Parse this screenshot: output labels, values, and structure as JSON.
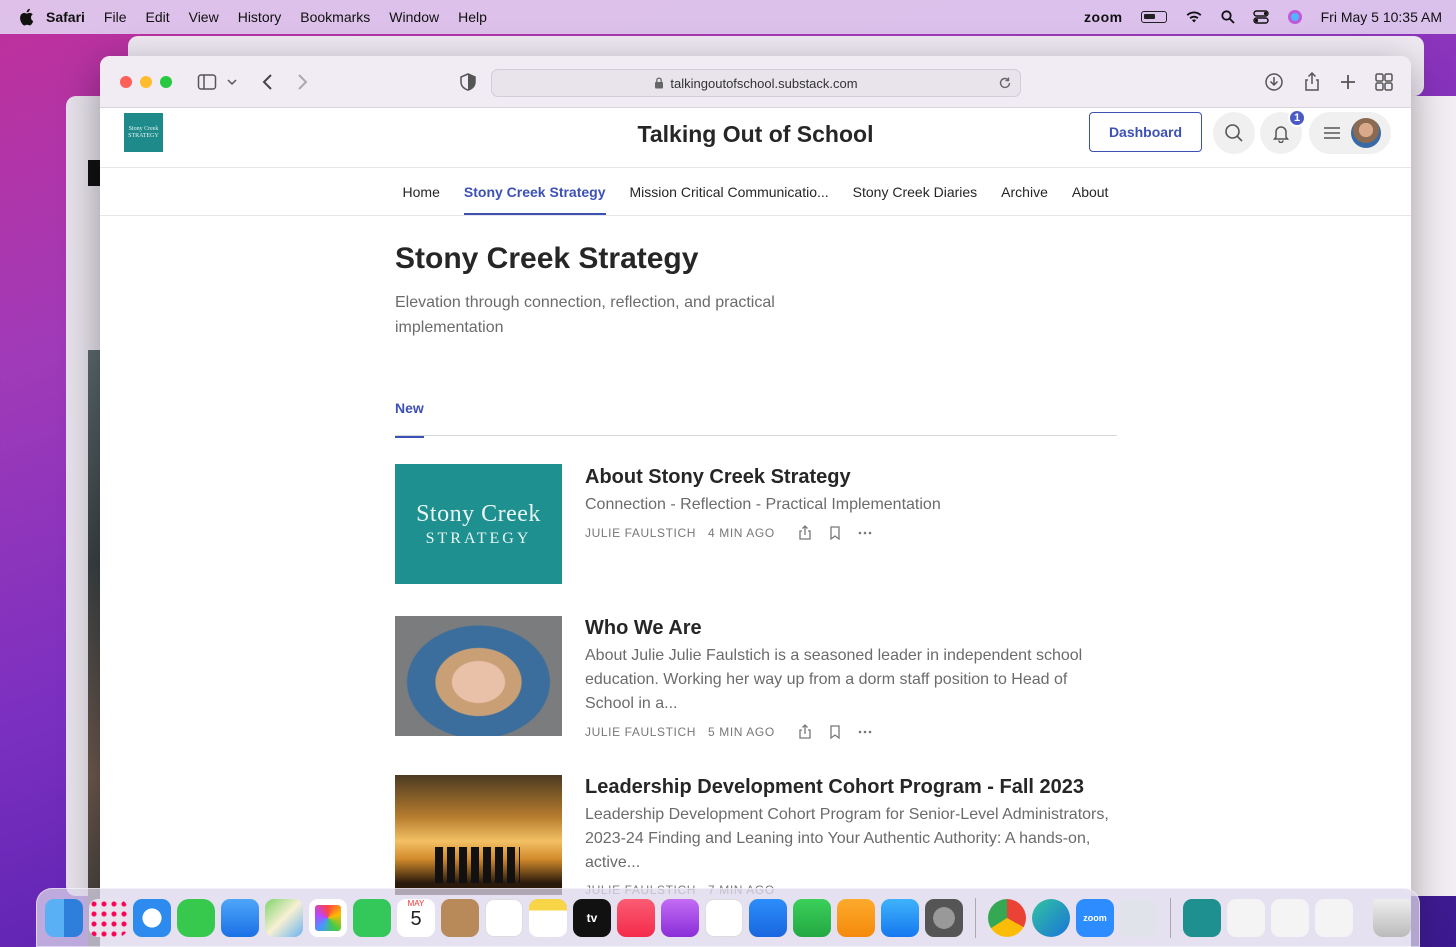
{
  "menubar": {
    "app": "Safari",
    "items": [
      "File",
      "Edit",
      "View",
      "History",
      "Bookmarks",
      "Window",
      "Help"
    ],
    "zoom_label": "zoom",
    "clock": "Fri May 5  10:35 AM"
  },
  "browser": {
    "url": "talkingoutofschool.substack.com"
  },
  "site": {
    "logo_line1": "Stony Creek",
    "logo_line2": "STRATEGY",
    "title": "Talking Out of School",
    "dashboard_label": "Dashboard",
    "notification_count": "1"
  },
  "nav": {
    "items": [
      "Home",
      "Stony Creek Strategy",
      "Mission Critical Communicatio...",
      "Stony Creek Diaries",
      "Archive",
      "About"
    ],
    "active": "Stony Creek Strategy"
  },
  "section": {
    "title": "Stony Creek Strategy",
    "description": "Elevation through connection, reflection, and practical implementation",
    "tab": "New"
  },
  "posts": [
    {
      "thumb_line1": "Stony Creek",
      "thumb_line2": "STRATEGY",
      "title": "About Stony Creek Strategy",
      "subtitle": "Connection - Reflection - Practical Implementation",
      "author": "JULIE FAULSTICH",
      "time": "4 MIN AGO"
    },
    {
      "title": "Who We Are",
      "subtitle": "About Julie Julie Faulstich is a seasoned leader in independent school education. Working her way up from a dorm staff position to Head of School in a...",
      "author": "JULIE FAULSTICH",
      "time": "5 MIN AGO"
    },
    {
      "title": "Leadership Development Cohort Program - Fall 2023",
      "subtitle": "Leadership Development Cohort Program for Senior-Level Administrators, 2023-24 Finding and Leaning into Your Authentic Authority: A hands-on, active...",
      "author": "JULIE FAULSTICH",
      "time": "7 MIN AGO"
    }
  ],
  "dock": {
    "calendar_month": "MAY",
    "calendar_day": "5",
    "tv_label": "tv",
    "zoom_label": "zoom"
  },
  "colors": {
    "accent": "#3d50b6",
    "teal": "#1e9090",
    "text": "#262626",
    "muted": "#6b6b6b"
  }
}
